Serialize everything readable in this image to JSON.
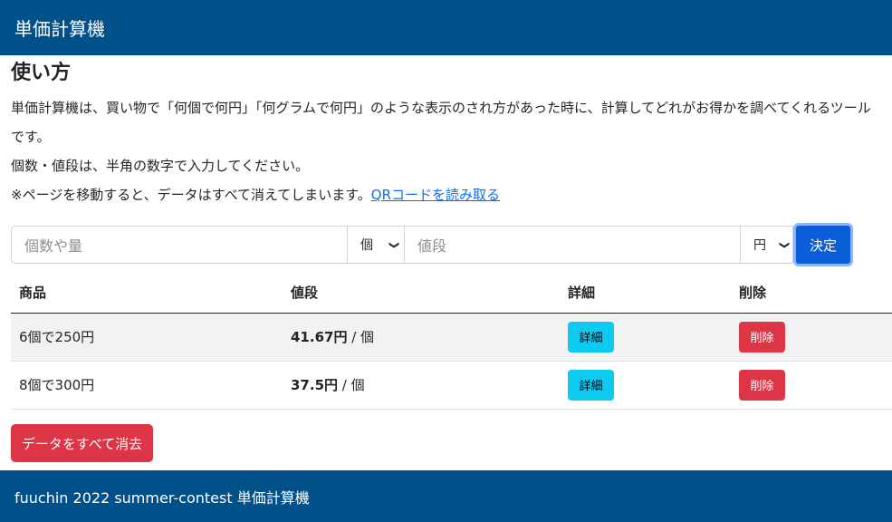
{
  "navbar": {
    "title": "単価計算機"
  },
  "main": {
    "heading": "使い方",
    "desc_line1": "単価計算機は、買い物で「何個で何円」「何グラムで何円」のような表示のされ方があった時に、計算してどれがお得かを調べてくれるツールです。",
    "desc_line2": "個数・値段は、半角の数字で入力してください。",
    "desc_line3": "※ページを移動すると、データはすべて消えてしまいます。",
    "qr_link": "QRコードを読み取る"
  },
  "form": {
    "qty_placeholder": "個数や量",
    "unit_selected": "個",
    "price_placeholder": "値段",
    "currency_selected": "円",
    "submit_label": "決定"
  },
  "table": {
    "headers": [
      "商品",
      "値段",
      "詳細",
      "削除"
    ],
    "rows": [
      {
        "product": "6個で250円",
        "unit_price": "41.67円",
        "per_unit": " / 個",
        "detail_label": "詳細",
        "delete_label": "削除"
      },
      {
        "product": "8個で300円",
        "unit_price": "37.5円",
        "per_unit": " / 個",
        "detail_label": "詳細",
        "delete_label": "削除"
      }
    ]
  },
  "actions": {
    "clear_all_label": "データをすべて消去"
  },
  "footer": {
    "text": "fuuchin 2022 summer-contest 単価計算機"
  },
  "colors": {
    "brand": "#00508a",
    "primary": "#0b5ed7",
    "info": "#0dcaf0",
    "danger": "#dc3545"
  }
}
